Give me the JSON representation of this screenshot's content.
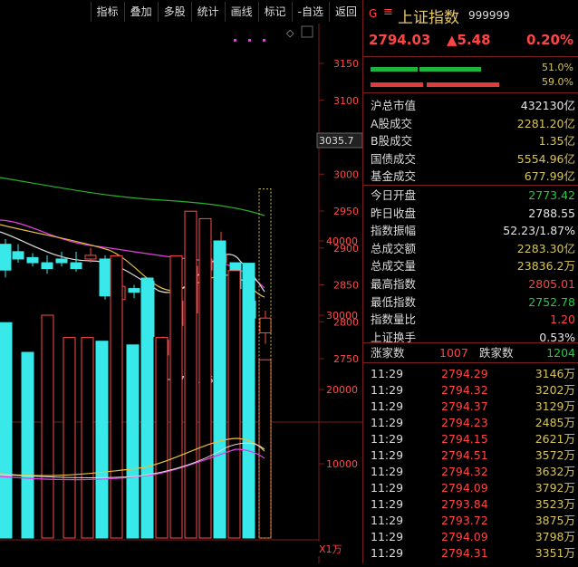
{
  "toolbar": {
    "buttons": [
      "指标",
      "叠加",
      "多股",
      "统计",
      "画线",
      "标记",
      "-自选",
      "返回"
    ]
  },
  "header": {
    "prefix": "G",
    "menu_icon": "≡",
    "name": "上证指数",
    "code": "999999",
    "price": "2794.03",
    "change": "▲5.48",
    "change_pct": "0.20%"
  },
  "ratio_bars": {
    "up_pct": "51.0%",
    "down_pct": "59.0%",
    "up_color": "#1fb53a",
    "down_color": "#e03c3c"
  },
  "stats_a": [
    {
      "label": "沪总市值",
      "value": "432130亿",
      "color": "white"
    },
    {
      "label": "A股成交",
      "value": "2281.20亿",
      "color": "yellow"
    },
    {
      "label": "B股成交",
      "value": "1.35亿",
      "color": "yellow"
    },
    {
      "label": "国债成交",
      "value": "5554.96亿",
      "color": "yellow"
    },
    {
      "label": "基金成交",
      "value": "677.99亿",
      "color": "yellow"
    }
  ],
  "stats_b": [
    {
      "label": "今日开盘",
      "value": "2773.42",
      "color": "green"
    },
    {
      "label": "昨日收盘",
      "value": "2788.55",
      "color": "white"
    },
    {
      "label": "指数振幅",
      "value": "52.23/1.87%",
      "color": "white"
    },
    {
      "label": "总成交额",
      "value": "2283.30亿",
      "color": "yellow"
    },
    {
      "label": "总成交量",
      "value": "23836.2万",
      "color": "yellow"
    },
    {
      "label": "最高指数",
      "value": "2805.01",
      "color": "red"
    },
    {
      "label": "最低指数",
      "value": "2752.78",
      "color": "green"
    },
    {
      "label": "指数量比",
      "value": "1.20",
      "color": "red"
    },
    {
      "label": "上证换手",
      "value": "0.53%",
      "color": "white"
    }
  ],
  "breadth": {
    "up_label": "涨家数",
    "up_value": "1007",
    "down_label": "跌家数",
    "down_value": "1204"
  },
  "ticks": [
    {
      "time": "11:29",
      "price": "2794.29",
      "vol": "3146万"
    },
    {
      "time": "11:29",
      "price": "2794.32",
      "vol": "3202万"
    },
    {
      "time": "11:29",
      "price": "2794.37",
      "vol": "3129万"
    },
    {
      "time": "11:29",
      "price": "2794.23",
      "vol": "2485万"
    },
    {
      "time": "11:29",
      "price": "2794.15",
      "vol": "2621万"
    },
    {
      "time": "11:29",
      "price": "2794.51",
      "vol": "3572万"
    },
    {
      "time": "11:29",
      "price": "2794.32",
      "vol": "3632万"
    },
    {
      "time": "11:29",
      "price": "2794.09",
      "vol": "3792万"
    },
    {
      "time": "11:29",
      "price": "2793.84",
      "vol": "3523万"
    },
    {
      "time": "11:29",
      "price": "2793.72",
      "vol": "3875万"
    },
    {
      "time": "11:29",
      "price": "2794.09",
      "vol": "3798万"
    },
    {
      "time": "11:29",
      "price": "2794.31",
      "vol": "3351万"
    }
  ],
  "chart": {
    "price_ticks": [
      "3150",
      "3100",
      "3050",
      "3000",
      "2950",
      "2900",
      "2850",
      "2800",
      "2750"
    ],
    "current_marker": "3035.7",
    "low_annotation": "2724.16",
    "vol_ticks": [
      "40000",
      "30000",
      "20000",
      "10000"
    ],
    "vol_unit": "X1万",
    "diamond": "◇"
  }
}
